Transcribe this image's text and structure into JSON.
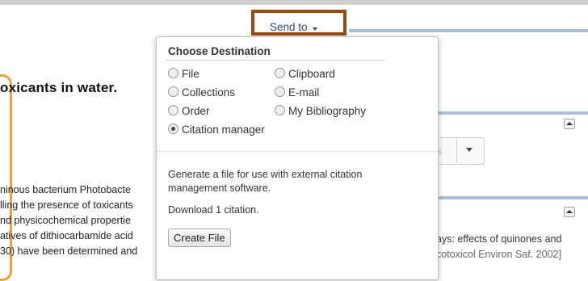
{
  "page": {
    "title": "oxicants in water.",
    "abstract_lines": [
      "ninous bacterium Photobacte",
      "lling the presence of toxicants",
      "nd physicochemical propertie",
      "atives of dithiocarbamide acid",
      "30) have been determined and"
    ],
    "ghost_select_text": "s",
    "related_line1": "ays: effects of quinones and",
    "related_line2": "cotoxicol Environ Saf. 2002]"
  },
  "send_to": {
    "label": "Send to",
    "heading": "Choose Destination",
    "options": [
      {
        "label": "File",
        "checked": false
      },
      {
        "label": "Clipboard",
        "checked": false
      },
      {
        "label": "Collections",
        "checked": false
      },
      {
        "label": "E-mail",
        "checked": false
      },
      {
        "label": "Order",
        "checked": false
      },
      {
        "label": "My Bibliography",
        "checked": false
      },
      {
        "label": "Citation manager",
        "checked": true
      }
    ],
    "description": "Generate a file for use with external citation management software.",
    "count_text": "Download 1 citation.",
    "create_button": "Create File"
  },
  "colors": {
    "sendto_highlight": "#9b4a14",
    "link_blue": "#2a4a7a",
    "accent_orange": "#f0a23a",
    "rule_blue": "#a9bfd6"
  }
}
